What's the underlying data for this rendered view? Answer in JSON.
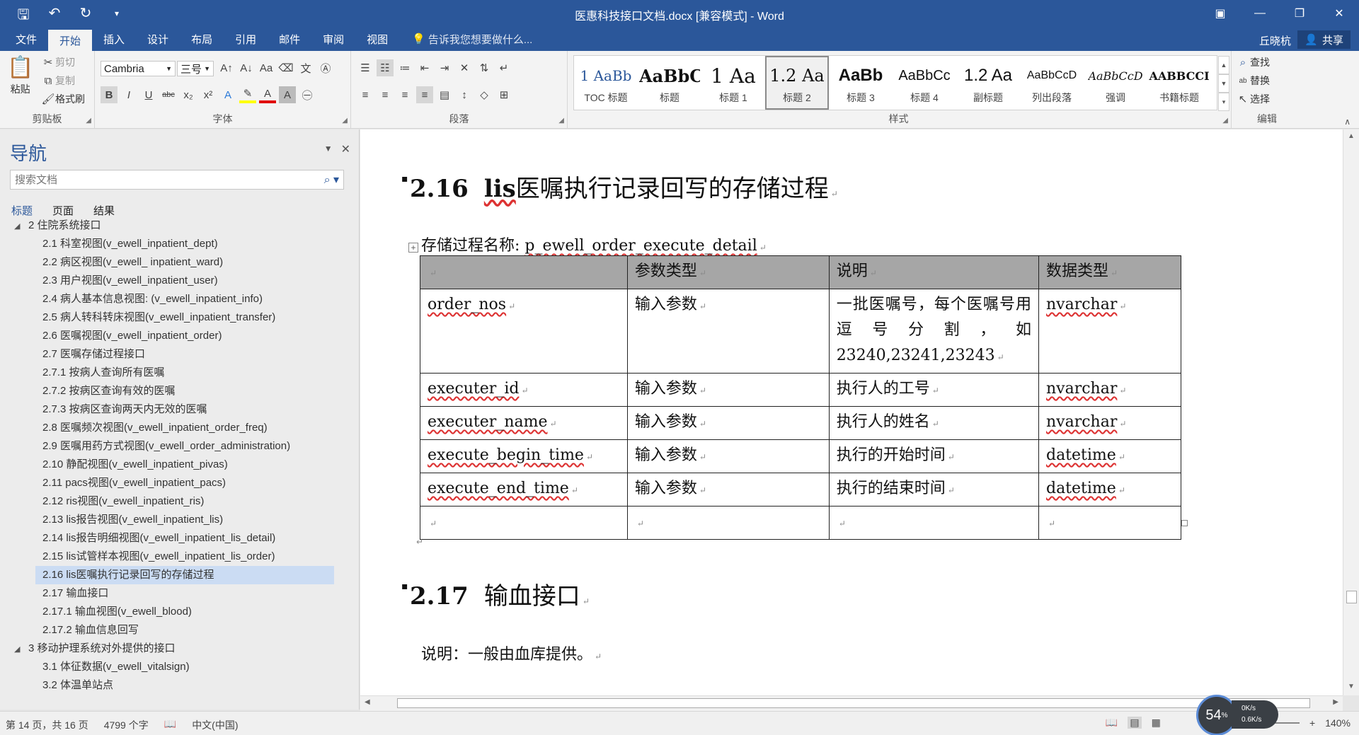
{
  "window": {
    "title": "医惠科技接口文档.docx [兼容模式] - Word"
  },
  "tabs": [
    "文件",
    "开始",
    "插入",
    "设计",
    "布局",
    "引用",
    "邮件",
    "审阅",
    "视图"
  ],
  "active_tab": "开始",
  "tell_me": "告诉我您想要做什么...",
  "user": "丘晓杭",
  "share_label": "共享",
  "ribbon": {
    "clipboard": {
      "paste": "粘贴",
      "cut": "剪切",
      "copy": "复制",
      "format_painter": "格式刷",
      "label": "剪贴板"
    },
    "font": {
      "name": "Cambria",
      "size": "三号",
      "label": "字体"
    },
    "paragraph": {
      "label": "段落"
    },
    "styles": {
      "label": "样式",
      "items": [
        {
          "preview": "1 AaBb",
          "name": "TOC 标题"
        },
        {
          "preview": "AaBbC",
          "name": "标题"
        },
        {
          "preview": "1 Aa",
          "name": "标题 1"
        },
        {
          "preview": "1.2 Aa",
          "name": "标题 2"
        },
        {
          "preview": "AaBb",
          "name": "标题 3"
        },
        {
          "preview": "AaBbCc",
          "name": "标题 4"
        },
        {
          "preview": "1.2 Aa",
          "name": "副标题"
        },
        {
          "preview": "AaBbCcD",
          "name": "列出段落"
        },
        {
          "preview": "AaBbCcD",
          "name": "强调"
        },
        {
          "preview": "AABBCCI",
          "name": "书籍标题"
        }
      ]
    },
    "editing": {
      "find": "查找",
      "replace": "替换",
      "select": "选择",
      "label": "编辑"
    }
  },
  "nav": {
    "title": "导航",
    "search_placeholder": "搜索文档",
    "tabs": [
      "标题",
      "页面",
      "结果"
    ],
    "tree": [
      {
        "level": 1,
        "text": "2 住院系统接口"
      },
      {
        "level": 2,
        "text": "2.1 科室视图(v_ewell_inpatient_dept)"
      },
      {
        "level": 2,
        "text": "2.2 病区视图(v_ewell_ inpatient_ward)"
      },
      {
        "level": 2,
        "text": "2.3 用户视图(v_ewell_inpatient_user)"
      },
      {
        "level": 2,
        "text": "2.4 病人基本信息视图: (v_ewell_inpatient_info)"
      },
      {
        "level": 2,
        "text": "2.5 病人转科转床视图(v_ewell_inpatient_transfer)"
      },
      {
        "level": 2,
        "text": "2.6 医嘱视图(v_ewell_inpatient_order)"
      },
      {
        "level": 2,
        "text": "2.7 医嘱存储过程接口"
      },
      {
        "level": 2,
        "text": "2.7.1 按病人查询所有医嘱"
      },
      {
        "level": 2,
        "text": "2.7.2 按病区查询有效的医嘱"
      },
      {
        "level": 2,
        "text": "2.7.3 按病区查询两天内无效的医嘱"
      },
      {
        "level": 2,
        "text": "2.8 医嘱频次视图(v_ewell_inpatient_order_freq)"
      },
      {
        "level": 2,
        "text": "2.9 医嘱用药方式视图(v_ewell_order_administration)"
      },
      {
        "level": 2,
        "text": "2.10 静配视图(v_ewell_inpatient_pivas)"
      },
      {
        "level": 2,
        "text": "2.11 pacs视图(v_ewell_inpatient_pacs)"
      },
      {
        "level": 2,
        "text": "2.12 ris视图(v_ewell_inpatient_ris)"
      },
      {
        "level": 2,
        "text": "2.13 lis报告视图(v_ewell_inpatient_lis)"
      },
      {
        "level": 2,
        "text": "2.14 lis报告明细视图(v_ewell_inpatient_lis_detail)"
      },
      {
        "level": 2,
        "text": "2.15 lis试管样本视图(v_ewell_inpatient_lis_order)"
      },
      {
        "level": 2,
        "text": "2.16 lis医嘱执行记录回写的存储过程",
        "selected": true
      },
      {
        "level": 2,
        "text": "2.17 输血接口"
      },
      {
        "level": 2,
        "text": "2.17.1 输血视图(v_ewell_blood)"
      },
      {
        "level": 2,
        "text": "2.17.2 输血信息回写"
      },
      {
        "level": 1,
        "text": "3 移动护理系统对外提供的接口"
      },
      {
        "level": 2,
        "text": "3.1 体征数据(v_ewell_vitalsign)"
      },
      {
        "level": 2,
        "text": "3.2 体温单站点"
      }
    ]
  },
  "document": {
    "heading1": {
      "number": "2.16",
      "lead": "lis",
      "rest": "医嘱执行记录回写的存储过程"
    },
    "proc_label": "存储过程名称: ",
    "proc_name": "p_ewell_order_execute_detail",
    "table": {
      "headers": [
        "",
        "参数类型",
        "说明",
        "数据类型"
      ],
      "rows": [
        [
          "order_nos",
          "输入参数",
          "一批医嘱号，每个医嘱号用逗号分割，如23240,23241,23243",
          "nvarchar"
        ],
        [
          "executer_id",
          "输入参数",
          "执行人的工号",
          "nvarchar"
        ],
        [
          "executer_name",
          "输入参数",
          "执行人的姓名",
          "nvarchar"
        ],
        [
          "execute_begin_time",
          "输入参数",
          "执行的开始时间",
          "datetime"
        ],
        [
          "execute_end_time",
          "输入参数",
          "执行的结束时间",
          "datetime"
        ],
        [
          "",
          "",
          "",
          ""
        ]
      ]
    },
    "heading2": {
      "number": "2.17",
      "text": "输血接口"
    },
    "note": "说明：一般由血库提供。"
  },
  "status": {
    "page": "第 14 页，共 16 页",
    "words": "4799 个字",
    "language": "中文(中国)",
    "zoom": "140%"
  },
  "overlay": {
    "percent": "54",
    "up": "0K/s",
    "down": "0.6K/s"
  }
}
